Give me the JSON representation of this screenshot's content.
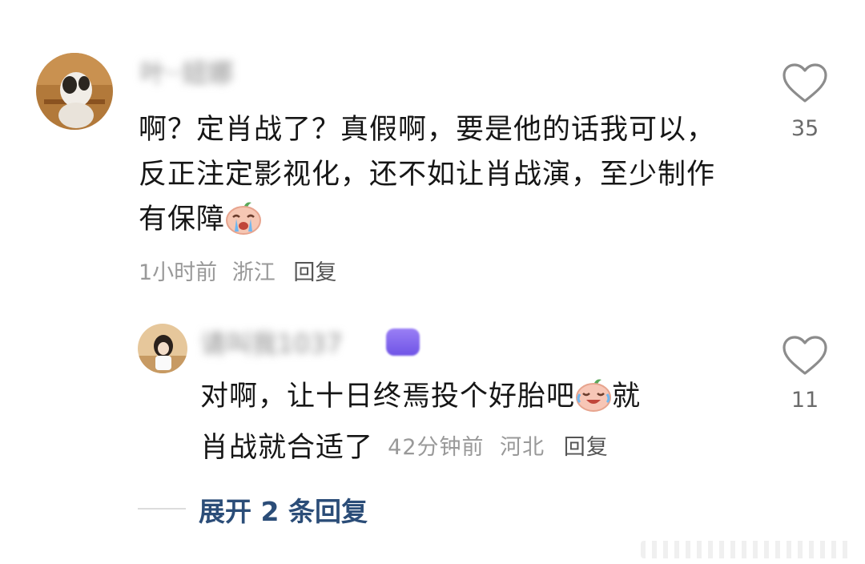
{
  "comment": {
    "username": "叶··妞娜",
    "text": "啊？定肖战了？真假啊，要是他的话我可以，反正注定影视化，还不如让肖战演，至少制作有保障",
    "emoji_icon": "crying-face-icon",
    "time": "1小时前",
    "location": "浙江",
    "reply_label": "回复",
    "like_count": "35"
  },
  "reply": {
    "username": "请叫我1037",
    "text_line1": "对啊，让十日终焉投个好胎吧",
    "emoji_icon": "tears-of-joy-icon",
    "text_line1_end": "就",
    "text_line2": "肖战就合适了",
    "time": "42分钟前",
    "location": "河北",
    "reply_label": "回复",
    "like_count": "11"
  },
  "expand_label": "展开 2 条回复",
  "colors": {
    "accent": "#2b4d78",
    "text": "#161616",
    "meta": "#999999"
  }
}
